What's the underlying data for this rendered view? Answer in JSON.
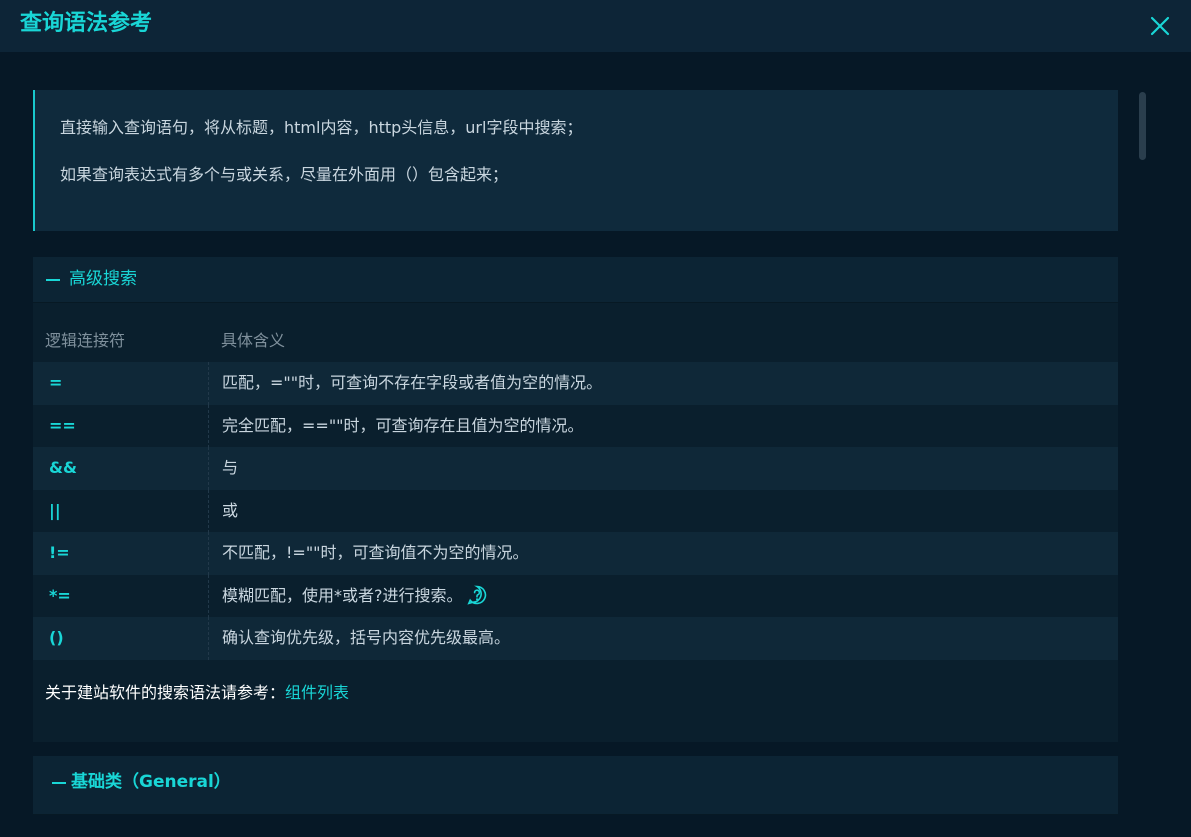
{
  "dialog": {
    "title": "查询语法参考",
    "close_icon": "close-icon"
  },
  "intro": {
    "lines": [
      "直接输入查询语句，将从标题，html内容，http头信息，url字段中搜索；",
      "如果查询表达式有多个与或关系，尽量在外面用（）包含起来；"
    ]
  },
  "advanced_section": {
    "toggle_icon": "collapse-dash-icon",
    "title": "高级搜索",
    "headers": {
      "operator": "逻辑连接符",
      "meaning": "具体含义"
    },
    "rows": [
      {
        "op": "=",
        "desc": "匹配，=\"\"时，可查询不存在字段或者值为空的情况。"
      },
      {
        "op": "==",
        "desc": "完全匹配，==\"\"时，可查询存在且值为空的情况。"
      },
      {
        "op": "&&",
        "desc": "与"
      },
      {
        "op": "||",
        "desc": "或"
      },
      {
        "op": "!=",
        "desc": "不匹配，!=\"\"时，可查询值不为空的情况。"
      },
      {
        "op": "*=",
        "desc": "模糊匹配，使用*或者?进行搜索。",
        "help_icon": "question-circle-icon"
      },
      {
        "op": "()",
        "desc": "确认查询优先级，括号内容优先级最高。"
      }
    ],
    "footer_text": "关于建站软件的搜索语法请参考：",
    "footer_link": "组件列表"
  },
  "general_section": {
    "toggle_icon": "collapse-dash-icon",
    "title": "基础类（General）"
  },
  "colors": {
    "accent": "#19d6d6",
    "background": "#061826",
    "header_bg": "#0d2537",
    "text": "#c9d6df"
  }
}
